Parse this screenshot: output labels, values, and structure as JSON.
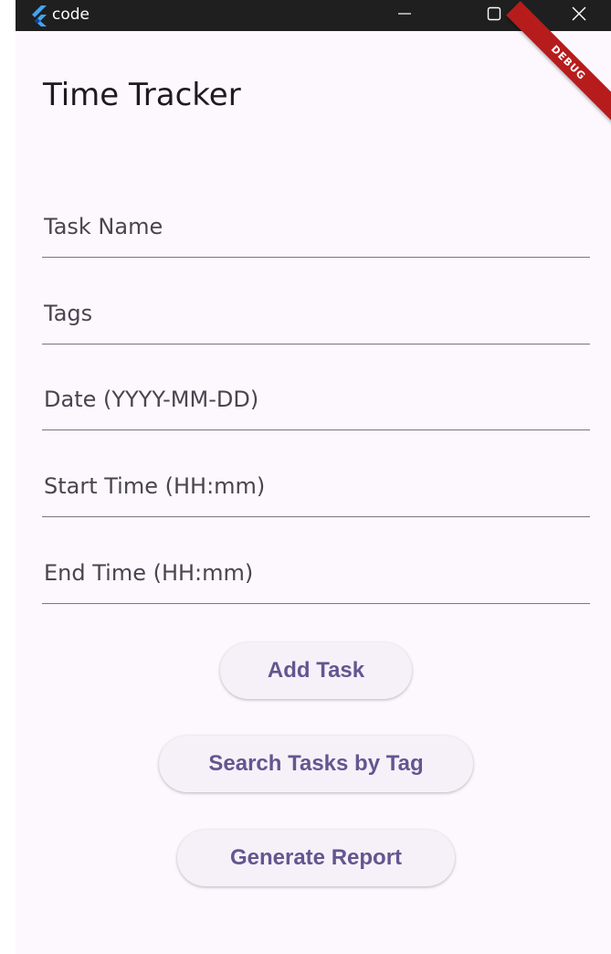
{
  "window": {
    "title": "code",
    "icon": "flutter-logo-icon",
    "controls": {
      "minimize_icon": "minimize-icon",
      "maximize_icon": "maximize-icon",
      "close_icon": "close-icon"
    }
  },
  "banner": {
    "label": "DEBUG"
  },
  "app_bar": {
    "title": "Time Tracker"
  },
  "form": {
    "task_name": {
      "value": "",
      "placeholder": "Task Name"
    },
    "tags": {
      "value": "",
      "placeholder": "Tags"
    },
    "date": {
      "value": "",
      "placeholder": "Date (YYYY-MM-DD)"
    },
    "start_time": {
      "value": "",
      "placeholder": "Start Time (HH:mm)"
    },
    "end_time": {
      "value": "",
      "placeholder": "End Time (HH:mm)"
    }
  },
  "actions": {
    "add_task": "Add Task",
    "search_tasks": "Search Tasks by Tag",
    "generate_report": "Generate Report"
  },
  "colors": {
    "background": "#fdf7fe",
    "titlebar": "#1f1f1f",
    "button_text": "#65558f",
    "button_bg": "#f6f1f9",
    "underline": "#7a757f",
    "debug_banner": "#b71c1c"
  }
}
